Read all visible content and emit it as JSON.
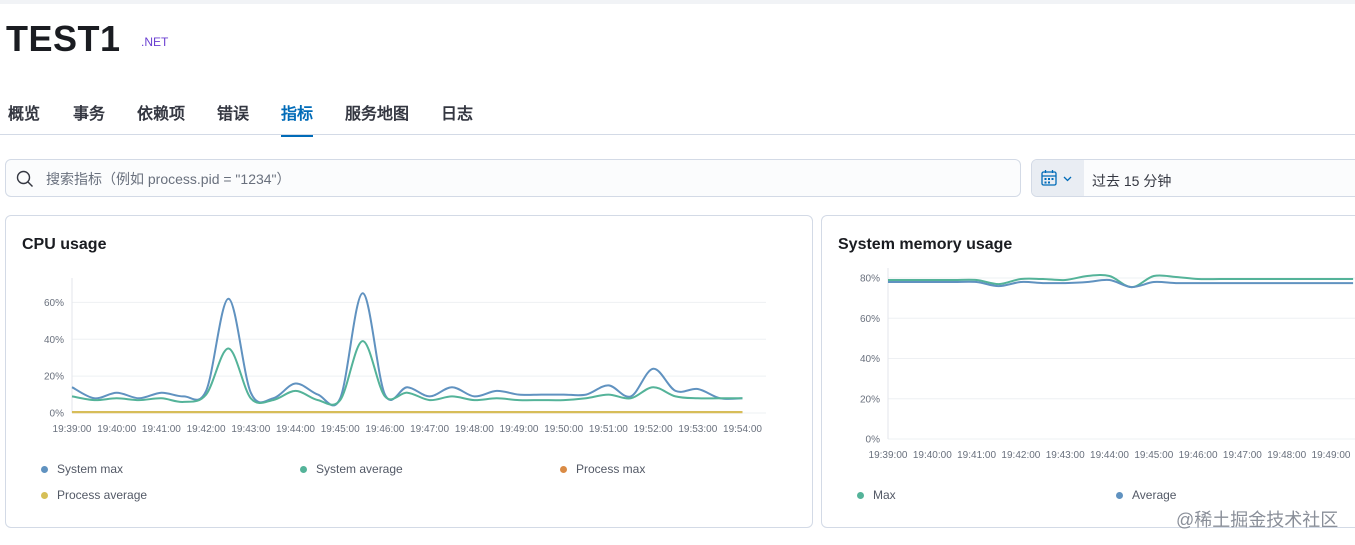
{
  "app": {
    "title": "TEST1",
    "language_badge": ".NET"
  },
  "tabs": [
    {
      "label": "概览"
    },
    {
      "label": "事务"
    },
    {
      "label": "依赖项"
    },
    {
      "label": "错误"
    },
    {
      "label": "指标"
    },
    {
      "label": "服务地图"
    },
    {
      "label": "日志"
    }
  ],
  "active_tab": "指标",
  "search": {
    "placeholder": "搜索指标（例如 process.pid = \"1234\"）",
    "value": ""
  },
  "datepicker": {
    "range_label": "过去 15 分钟",
    "icon": "calendar-icon"
  },
  "colors": {
    "accent": "#006bb8",
    "series_blue": "#6092c0",
    "series_green": "#54b399",
    "series_orange": "#d6bf57",
    "series_tan": "#da8b45"
  },
  "chart_data": [
    {
      "type": "line",
      "title": "CPU usage",
      "x": [
        "19:39:00",
        "19:40:00",
        "19:41:00",
        "19:42:00",
        "19:43:00",
        "19:44:00",
        "19:45:00",
        "19:46:00",
        "19:47:00",
        "19:48:00",
        "19:49:00",
        "19:50:00",
        "19:51:00",
        "19:52:00",
        "19:53:00",
        "19:54:00"
      ],
      "y_ticks": [
        "0%",
        "20%",
        "40%",
        "60%"
      ],
      "ylim": [
        0,
        70
      ],
      "grid": true,
      "legend_position": "bottom",
      "series": [
        {
          "name": "System max",
          "color": "#6092c0",
          "points": [
            [
              0,
              14
            ],
            [
              0.5,
              8
            ],
            [
              1,
              11
            ],
            [
              1.5,
              8
            ],
            [
              2,
              11
            ],
            [
              2.5,
              9
            ],
            [
              3,
              12
            ],
            [
              3.5,
              62
            ],
            [
              4,
              11
            ],
            [
              4.5,
              8
            ],
            [
              5,
              16
            ],
            [
              5.5,
              10
            ],
            [
              6,
              8
            ],
            [
              6.5,
              65
            ],
            [
              7,
              10
            ],
            [
              7.5,
              14
            ],
            [
              8,
              9
            ],
            [
              8.5,
              14
            ],
            [
              9,
              9
            ],
            [
              9.5,
              12
            ],
            [
              10,
              10
            ],
            [
              10.5,
              10
            ],
            [
              11,
              10
            ],
            [
              11.5,
              10
            ],
            [
              12,
              15
            ],
            [
              12.5,
              9
            ],
            [
              13,
              24
            ],
            [
              13.5,
              12
            ],
            [
              14,
              13
            ],
            [
              14.5,
              8
            ],
            [
              15,
              8
            ]
          ]
        },
        {
          "name": "System average",
          "color": "#54b399",
          "points": [
            [
              0,
              9
            ],
            [
              0.5,
              7
            ],
            [
              1,
              8
            ],
            [
              1.5,
              7
            ],
            [
              2,
              8
            ],
            [
              2.5,
              6
            ],
            [
              3,
              10
            ],
            [
              3.5,
              35
            ],
            [
              4,
              8
            ],
            [
              4.5,
              7
            ],
            [
              5,
              12
            ],
            [
              5.5,
              7
            ],
            [
              6,
              7
            ],
            [
              6.5,
              39
            ],
            [
              7,
              9
            ],
            [
              7.5,
              11
            ],
            [
              8,
              7
            ],
            [
              8.5,
              9
            ],
            [
              9,
              7
            ],
            [
              9.5,
              8
            ],
            [
              10,
              7
            ],
            [
              10.5,
              7
            ],
            [
              11,
              7
            ],
            [
              11.5,
              8
            ],
            [
              12,
              10
            ],
            [
              12.5,
              8
            ],
            [
              13,
              14
            ],
            [
              13.5,
              9
            ],
            [
              14,
              8
            ],
            [
              14.5,
              8
            ],
            [
              15,
              8
            ]
          ]
        },
        {
          "name": "Process max",
          "color": "#da8b45",
          "points": [
            [
              0,
              0.5
            ],
            [
              15,
              0.5
            ]
          ]
        },
        {
          "name": "Process average",
          "color": "#d6bf57",
          "points": [
            [
              0,
              0.5
            ],
            [
              15,
              0.5
            ]
          ]
        }
      ]
    },
    {
      "type": "line",
      "title": "System memory usage",
      "x": [
        "19:39:00",
        "19:40:00",
        "19:41:00",
        "19:42:00",
        "19:43:00",
        "19:44:00",
        "19:45:00",
        "19:46:00",
        "19:47:00",
        "19:48:00",
        "19:49:00"
      ],
      "y_ticks": [
        "0%",
        "20%",
        "40%",
        "60%",
        "80%"
      ],
      "ylim": [
        0,
        82
      ],
      "grid": true,
      "legend_position": "bottom",
      "series": [
        {
          "name": "Max",
          "color": "#54b399",
          "points": [
            [
              0,
              79
            ],
            [
              0.5,
              79
            ],
            [
              1,
              79
            ],
            [
              1.5,
              79
            ],
            [
              2,
              79
            ],
            [
              2.5,
              77
            ],
            [
              3,
              79.5
            ],
            [
              3.5,
              79.5
            ],
            [
              4,
              79
            ],
            [
              4.5,
              81
            ],
            [
              5,
              81
            ],
            [
              5.5,
              75.5
            ],
            [
              6,
              81
            ],
            [
              6.5,
              80.5
            ],
            [
              7,
              79.5
            ],
            [
              7.5,
              79.5
            ],
            [
              8,
              79.5
            ],
            [
              8.5,
              79.5
            ],
            [
              9,
              79.5
            ],
            [
              9.5,
              79.5
            ],
            [
              10.5,
              79.5
            ]
          ]
        },
        {
          "name": "Average",
          "color": "#6092c0",
          "points": [
            [
              0,
              78
            ],
            [
              0.5,
              78
            ],
            [
              1,
              78
            ],
            [
              1.5,
              78
            ],
            [
              2,
              78
            ],
            [
              2.5,
              76
            ],
            [
              3,
              78
            ],
            [
              3.5,
              77.5
            ],
            [
              4,
              77.5
            ],
            [
              4.5,
              78
            ],
            [
              5,
              79
            ],
            [
              5.5,
              75.5
            ],
            [
              6,
              78
            ],
            [
              6.5,
              77.5
            ],
            [
              7,
              77.5
            ],
            [
              7.5,
              77.5
            ],
            [
              8,
              77.5
            ],
            [
              8.5,
              77.5
            ],
            [
              9,
              77.5
            ],
            [
              9.5,
              77.5
            ],
            [
              10.5,
              77.5
            ]
          ]
        }
      ]
    }
  ],
  "watermark": "@稀土掘金技术社区"
}
